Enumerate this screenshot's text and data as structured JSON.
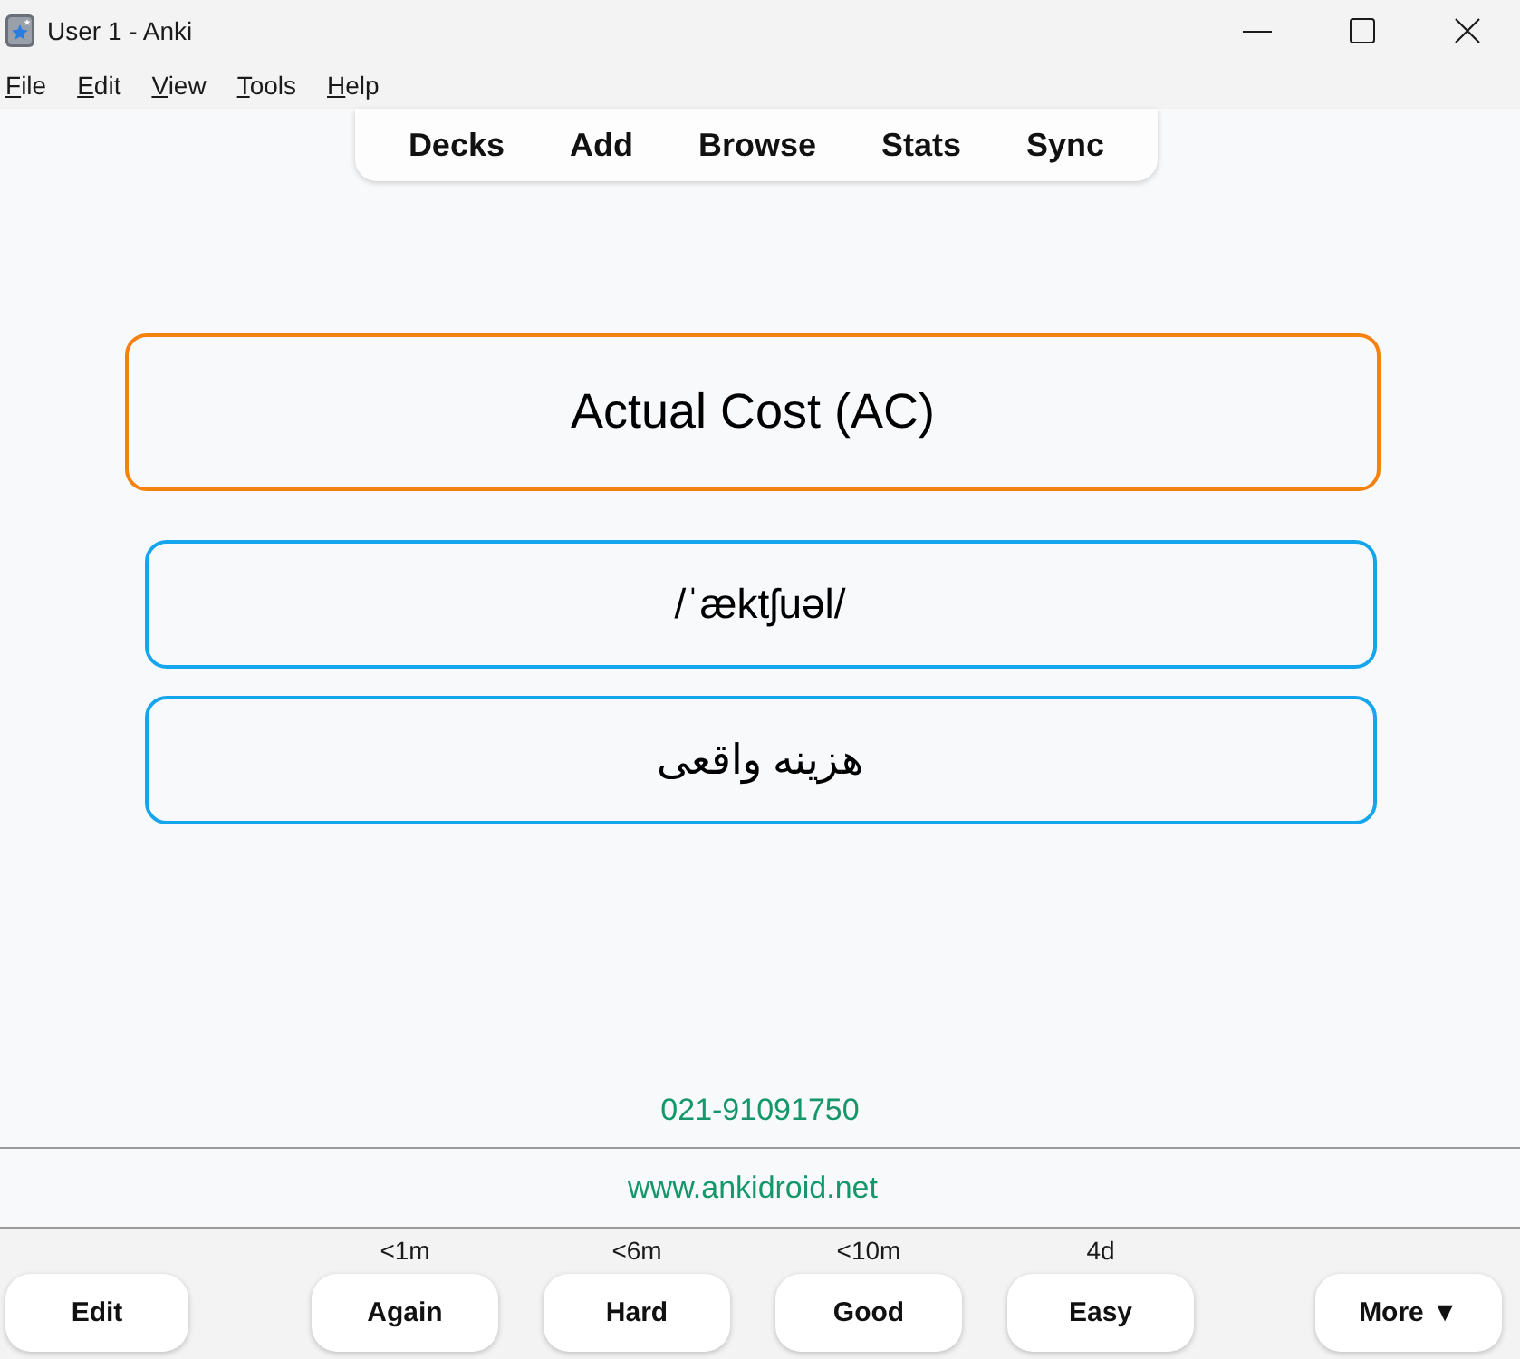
{
  "window": {
    "title": "User 1 - Anki"
  },
  "menu": [
    "File",
    "Edit",
    "View",
    "Tools",
    "Help"
  ],
  "toolbar": [
    "Decks",
    "Add",
    "Browse",
    "Stats",
    "Sync"
  ],
  "card": {
    "fields": [
      {
        "kind": "title",
        "text": "Actual Cost (AC)",
        "color": "#f5820e"
      },
      {
        "kind": "detail",
        "text": "/ˈæktʃuəl/",
        "color": "#14a5ec"
      },
      {
        "kind": "detail",
        "text": "هزینه واقعی",
        "color": "#14a5ec"
      }
    ],
    "phone": "021-91091750",
    "website": "www.ankidroid.net"
  },
  "bottom_bar": {
    "edit_button": "Edit",
    "answer_buttons": [
      {
        "label": "Again",
        "interval": "<1m"
      },
      {
        "label": "Hard",
        "interval": "<6m"
      },
      {
        "label": "Good",
        "interval": "<10m"
      },
      {
        "label": "Easy",
        "interval": "4d"
      }
    ],
    "more_button": "More ▼"
  }
}
